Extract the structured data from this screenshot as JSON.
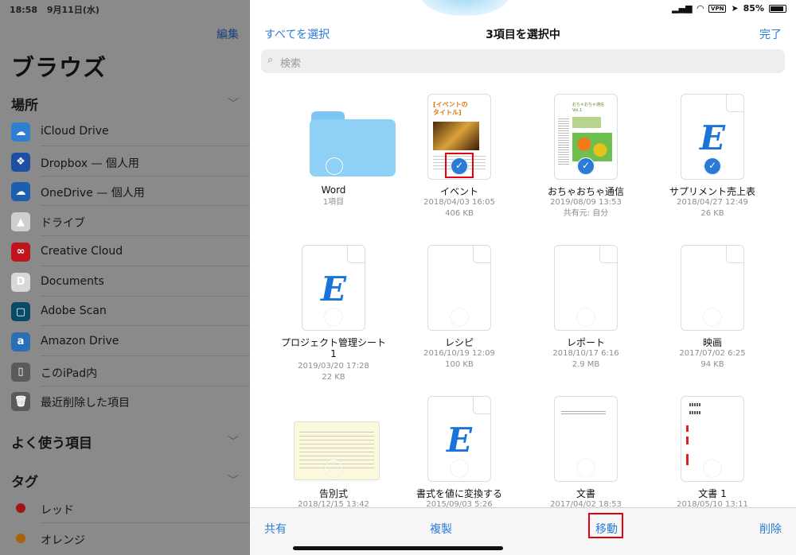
{
  "sidebar": {
    "status_time": "18:58",
    "status_date": "9月11日(水)",
    "edit_label": "編集",
    "title": "ブラウズ",
    "locations_header": "場所",
    "locations": [
      {
        "label": "iCloud Drive",
        "icon": "icloud-icon",
        "color": "#2f7fd0"
      },
      {
        "label": "Dropbox — 個人用",
        "icon": "dropbox-icon",
        "color": "#1d4fa3"
      },
      {
        "label": "OneDrive — 個人用",
        "icon": "onedrive-icon",
        "color": "#1c5fb0"
      },
      {
        "label": "ドライブ",
        "icon": "google-drive-icon",
        "color": "#cfcfcf"
      },
      {
        "label": "Creative Cloud",
        "icon": "creative-cloud-icon",
        "color": "#c0141f"
      },
      {
        "label": "Documents",
        "icon": "documents-icon",
        "color": "#d8d8d8"
      },
      {
        "label": "Adobe Scan",
        "icon": "adobe-scan-icon",
        "color": "#0b4a66"
      },
      {
        "label": "Amazon Drive",
        "icon": "amazon-drive-icon",
        "color": "#2a6fb5"
      },
      {
        "label": "このiPad内",
        "icon": "ipad-icon",
        "color": "#5a5a5a"
      },
      {
        "label": "最近削除した項目",
        "icon": "trash-icon",
        "color": "#5a5a5a"
      }
    ],
    "favorites_header": "よく使う項目",
    "tags_header": "タグ",
    "tags": [
      {
        "label": "レッド",
        "color": "#a0141a"
      },
      {
        "label": "オレンジ",
        "color": "#a8620a"
      }
    ]
  },
  "main": {
    "status_battery": "85%",
    "select_all": "すべてを選択",
    "title": "3項目を選択中",
    "done": "完了",
    "search_placeholder": "検索",
    "files": [
      {
        "name": "Word",
        "line1": "1項目",
        "line2": "",
        "line3": "",
        "kind": "folder",
        "selected": false
      },
      {
        "name": "イベント",
        "line1": "2018/04/03 16:05",
        "line2": "406 KB",
        "line3": "",
        "kind": "event",
        "selected": true
      },
      {
        "name": "おちゃおちゃ通信",
        "line1": "2019/08/09 13:53",
        "line2": "共有元: 自分",
        "line3": "",
        "kind": "ocha",
        "selected": true
      },
      {
        "name": "サプリメント売上表",
        "line1": "2018/04/27 12:49",
        "line2": "26 KB",
        "line3": "",
        "kind": "e-doc",
        "selected": true
      },
      {
        "name": "プロジェクト管理シート",
        "name2": "1",
        "line1": "2019/03/20 17:28",
        "line2": "22 KB",
        "line3": "",
        "kind": "e-doc",
        "selected": false
      },
      {
        "name": "レシピ",
        "line1": "2016/10/19 12:09",
        "line2": "100 KB",
        "line3": "",
        "kind": "blank",
        "selected": false
      },
      {
        "name": "レポート",
        "line1": "2018/10/17 6:16",
        "line2": "2.9 MB",
        "line3": "",
        "kind": "blank",
        "selected": false
      },
      {
        "name": "映画",
        "line1": "2017/07/02 6:25",
        "line2": "94 KB",
        "line3": "",
        "kind": "blank",
        "selected": false
      },
      {
        "name": "告別式",
        "line1": "2018/12/15 13:42",
        "line2": "",
        "line3": "",
        "kind": "funeral",
        "selected": false
      },
      {
        "name": "書式を値に変換する",
        "line1": "2015/09/03 5:26",
        "line2": "",
        "line3": "",
        "kind": "e-doc",
        "selected": false
      },
      {
        "name": "文書",
        "line1": "2017/04/02 18:53",
        "line2": "",
        "line3": "",
        "kind": "bunsho",
        "selected": false
      },
      {
        "name": "文書 1",
        "line1": "2018/05/10 13:11",
        "line2": "",
        "line3": "",
        "kind": "bunsho1",
        "selected": false
      }
    ],
    "event_thumb_title": "[イベントの\nタイトル]",
    "ocha_thumb_head": "おちゃおちゃ通信\nVol.1",
    "toolbar": {
      "share": "共有",
      "duplicate": "複製",
      "move": "移動",
      "delete": "削除"
    }
  },
  "colors": {
    "accent": "#2a7bd6",
    "highlight_box": "#e60012",
    "sidebar_dim": "#8a8a8a"
  }
}
